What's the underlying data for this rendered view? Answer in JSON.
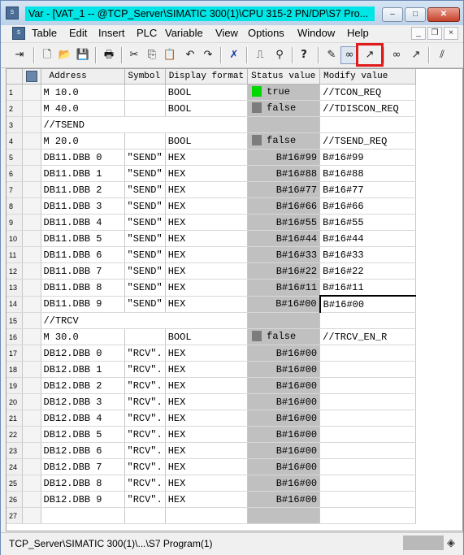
{
  "window": {
    "title": "Var - [VAT_1 -- @TCP_Server\\SIMATIC 300(1)\\CPU 315-2 PN/DP\\S7 Pro...",
    "app_icon": "simatic-var-icon",
    "controls": {
      "minimize": "–",
      "maximize": "□",
      "close": "✕"
    }
  },
  "menubar": {
    "items": [
      "Table",
      "Edit",
      "Insert",
      "PLC",
      "Variable",
      "View",
      "Options",
      "Window",
      "Help"
    ],
    "mdi": {
      "minimize": "_",
      "restore": "❐",
      "close": "×"
    }
  },
  "toolbar": {
    "buttons": [
      {
        "name": "insert-row-icon",
        "glyph": "⇥"
      },
      {
        "name": "new-icon",
        "glyph": "🗋"
      },
      {
        "name": "open-icon",
        "glyph": "📂"
      },
      {
        "name": "save-icon",
        "glyph": "💾"
      },
      {
        "name": "print-icon",
        "glyph": "🖶"
      },
      {
        "name": "cut-icon",
        "glyph": "✂"
      },
      {
        "name": "copy-icon",
        "glyph": "⎘"
      },
      {
        "name": "paste-icon",
        "glyph": "📋"
      },
      {
        "name": "undo-icon",
        "glyph": "↶"
      },
      {
        "name": "redo-icon",
        "glyph": "↷"
      },
      {
        "name": "delete-icon",
        "glyph": "✗"
      },
      {
        "name": "online-connect-icon",
        "glyph": "⎍"
      },
      {
        "name": "trigger-icon",
        "glyph": "⚲"
      },
      {
        "name": "help-icon",
        "glyph": "?"
      },
      {
        "name": "monitor-variable-icon",
        "glyph": "✎"
      },
      {
        "name": "monitor-glasses-icon",
        "glyph": "∞"
      },
      {
        "name": "modify-variable-icon",
        "glyph": "↗"
      },
      {
        "name": "update-monitor-icon",
        "glyph": "∞"
      },
      {
        "name": "activate-modify-icon",
        "glyph": "↗"
      },
      {
        "name": "force-icon",
        "glyph": "⫽"
      }
    ],
    "active_button": "modify-variable-icon",
    "highlight_color": "#e01b1b"
  },
  "table": {
    "headers": {
      "address": "Address",
      "symbol": "Symbol",
      "display_format": "Display format",
      "status_value": "Status value",
      "modify_value": "Modify value"
    },
    "rows": [
      {
        "n": "1",
        "address": "M      10.0",
        "symbol": "",
        "format": "BOOL",
        "status": "true",
        "ind": "green",
        "modify": "//TCON_REQ"
      },
      {
        "n": "2",
        "address": "M      40.0",
        "symbol": "",
        "format": "BOOL",
        "status": "false",
        "ind": "gray",
        "modify": "//TDISCON_REQ"
      },
      {
        "n": "3",
        "comment": "//TSEND"
      },
      {
        "n": "4",
        "address": "M      20.0",
        "symbol": "",
        "format": "BOOL",
        "status": "false",
        "ind": "gray",
        "modify": "//TSEND_REQ"
      },
      {
        "n": "5",
        "address": "DB11.DBB    0",
        "symbol": "\"SEND\"",
        "format": "HEX",
        "status": "B#16#99",
        "modify": "B#16#99"
      },
      {
        "n": "6",
        "address": "DB11.DBB    1",
        "symbol": "\"SEND\"",
        "format": "HEX",
        "status": "B#16#88",
        "modify": "B#16#88"
      },
      {
        "n": "7",
        "address": "DB11.DBB    2",
        "symbol": "\"SEND\"",
        "format": "HEX",
        "status": "B#16#77",
        "modify": "B#16#77"
      },
      {
        "n": "8",
        "address": "DB11.DBB    3",
        "symbol": "\"SEND\"",
        "format": "HEX",
        "status": "B#16#66",
        "modify": "B#16#66"
      },
      {
        "n": "9",
        "address": "DB11.DBB    4",
        "symbol": "\"SEND\"",
        "format": "HEX",
        "status": "B#16#55",
        "modify": "B#16#55"
      },
      {
        "n": "10",
        "address": "DB11.DBB    5",
        "symbol": "\"SEND\"",
        "format": "HEX",
        "status": "B#16#44",
        "modify": "B#16#44"
      },
      {
        "n": "11",
        "address": "DB11.DBB    6",
        "symbol": "\"SEND\"",
        "format": "HEX",
        "status": "B#16#33",
        "modify": "B#16#33"
      },
      {
        "n": "12",
        "address": "DB11.DBB    7",
        "symbol": "\"SEND\"",
        "format": "HEX",
        "status": "B#16#22",
        "modify": "B#16#22"
      },
      {
        "n": "13",
        "address": "DB11.DBB    8",
        "symbol": "\"SEND\"",
        "format": "HEX",
        "status": "B#16#11",
        "modify": "B#16#11"
      },
      {
        "n": "14",
        "address": "DB11.DBB    9",
        "symbol": "\"SEND\"",
        "format": "HEX",
        "status": "B#16#00",
        "modify": "B#16#00",
        "active": true
      },
      {
        "n": "15",
        "comment": "//TRCV"
      },
      {
        "n": "16",
        "address": "M      30.0",
        "symbol": "",
        "format": "BOOL",
        "status": "false",
        "ind": "gray",
        "modify": "//TRCV_EN_R"
      },
      {
        "n": "17",
        "address": "DB12.DBB    0",
        "symbol": "\"RCV\".",
        "format": "HEX",
        "status": "B#16#00",
        "modify": ""
      },
      {
        "n": "18",
        "address": "DB12.DBB    1",
        "symbol": "\"RCV\".",
        "format": "HEX",
        "status": "B#16#00",
        "modify": ""
      },
      {
        "n": "19",
        "address": "DB12.DBB    2",
        "symbol": "\"RCV\".",
        "format": "HEX",
        "status": "B#16#00",
        "modify": ""
      },
      {
        "n": "20",
        "address": "DB12.DBB    3",
        "symbol": "\"RCV\".",
        "format": "HEX",
        "status": "B#16#00",
        "modify": ""
      },
      {
        "n": "21",
        "address": "DB12.DBB    4",
        "symbol": "\"RCV\".",
        "format": "HEX",
        "status": "B#16#00",
        "modify": ""
      },
      {
        "n": "22",
        "address": "DB12.DBB    5",
        "symbol": "\"RCV\".",
        "format": "HEX",
        "status": "B#16#00",
        "modify": ""
      },
      {
        "n": "23",
        "address": "DB12.DBB    6",
        "symbol": "\"RCV\".",
        "format": "HEX",
        "status": "B#16#00",
        "modify": ""
      },
      {
        "n": "24",
        "address": "DB12.DBB    7",
        "symbol": "\"RCV\".",
        "format": "HEX",
        "status": "B#16#00",
        "modify": ""
      },
      {
        "n": "25",
        "address": "DB12.DBB    8",
        "symbol": "\"RCV\".",
        "format": "HEX",
        "status": "B#16#00",
        "modify": ""
      },
      {
        "n": "26",
        "address": "DB12.DBB    9",
        "symbol": "\"RCV\".",
        "format": "HEX",
        "status": "B#16#00",
        "modify": ""
      },
      {
        "n": "27",
        "address": "",
        "symbol": "",
        "format": "",
        "status": "",
        "modify": ""
      }
    ]
  },
  "statusbar": {
    "text": "TCP_Server\\SIMATIC 300(1)\\...\\S7 Program(1)",
    "icon": "connection-status-icon",
    "icon_glyph": "◈"
  }
}
